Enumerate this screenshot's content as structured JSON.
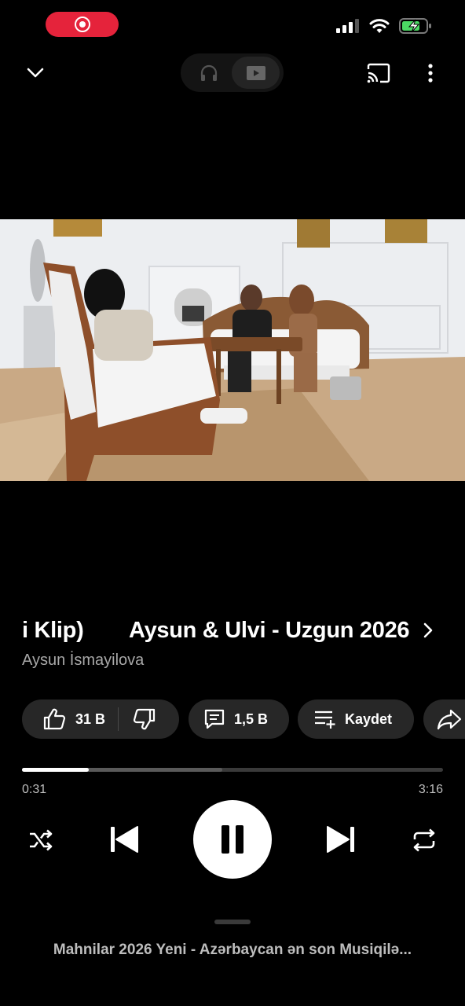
{
  "status_bar": {
    "recording_icon": "screen-record-icon",
    "icons": [
      "cellular-signal-icon",
      "wifi-icon",
      "battery-charging-icon"
    ],
    "battery_color": "#4cd964"
  },
  "top_bar": {
    "collapse_icon": "chevron-down-icon",
    "mode_audio_icon": "headphones-icon",
    "mode_video_icon": "video-icon",
    "cast_icon": "cast-icon",
    "more_icon": "more-vertical-icon"
  },
  "video": {
    "thumbnail_icon": "video-frame"
  },
  "track": {
    "title_scroll_tail": "i Klip)",
    "title": "Aysun & Ulvi - Uzgun 2026",
    "channel": "Aysun İsmayilova"
  },
  "actions": {
    "likes": "31 B",
    "comments": "1,5 B",
    "save_label": "Kaydet"
  },
  "progress": {
    "current": "0:31",
    "duration": "3:16",
    "fraction": 0.158
  },
  "controls": {
    "shuffle_icon": "shuffle-icon",
    "previous_icon": "skip-previous-icon",
    "pause_icon": "pause-icon",
    "next_icon": "skip-next-icon",
    "repeat_icon": "repeat-icon"
  },
  "playlist": {
    "title": "Mahnilar 2026 Yeni - Azərbaycan ən son Musiqilə..."
  },
  "colors": {
    "background": "#000000",
    "chip": "#272727",
    "record": "#e5233b",
    "secondary_text": "#a8a8a8"
  }
}
